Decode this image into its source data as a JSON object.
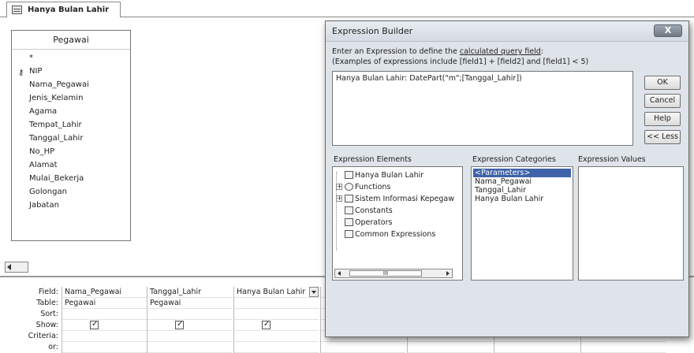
{
  "tab": {
    "title": "Hanya Bulan Lahir",
    "icon": "query-table-icon"
  },
  "table": {
    "name": "Pegawai",
    "fields": [
      "*",
      "NIP",
      "Nama_Pegawai",
      "Jenis_Kelamin",
      "Agama",
      "Tempat_Lahir",
      "Tanggal_Lahir",
      "No_HP",
      "Alamat",
      "Mulai_Bekerja",
      "Golongan",
      "Jabatan"
    ],
    "key_field": "NIP"
  },
  "grid": {
    "row_labels": [
      "Field:",
      "Table:",
      "Sort:",
      "Show:",
      "Criteria:",
      "or:"
    ],
    "columns": [
      {
        "field": "Nama_Pegawai",
        "table": "Pegawai",
        "sort": "",
        "show": true
      },
      {
        "field": "Tanggal_Lahir",
        "table": "Pegawai",
        "sort": "",
        "show": true
      },
      {
        "field": "Hanya Bulan Lahir",
        "table": "",
        "sort": "",
        "show": true
      }
    ]
  },
  "dialog": {
    "title": "Expression Builder",
    "close_label": "X",
    "instruction_pre": "Enter an Expression to define the ",
    "instruction_link": "calculated query field",
    "instruction_post": ":",
    "examples": "(Examples of expressions include [field1] + [field2] and [field1] < 5)",
    "expression": "Hanya Bulan Lahir: DatePart(\"m\";[Tanggal_Lahir])",
    "buttons": {
      "ok": "OK",
      "cancel": "Cancel",
      "help": "Help",
      "less": "<< Less"
    },
    "elements_label": "Expression Elements",
    "categories_label": "Expression Categories",
    "values_label": "Expression Values",
    "elements": [
      {
        "label": "Hanya Bulan Lahir",
        "expandable": false,
        "icon": "query-icon"
      },
      {
        "label": "Functions",
        "expandable": true,
        "icon": "function-icon"
      },
      {
        "label": "Sistem Informasi Kepegaw",
        "expandable": true,
        "icon": "database-icon"
      },
      {
        "label": "Constants",
        "expandable": false,
        "icon": "constants-icon"
      },
      {
        "label": "Operators",
        "expandable": false,
        "icon": "operators-icon"
      },
      {
        "label": "Common Expressions",
        "expandable": false,
        "icon": "common-expressions-icon"
      }
    ],
    "categories": [
      "<Parameters>",
      "Nama_Pegawai",
      "Tanggal_Lahir",
      "Hanya Bulan Lahir"
    ],
    "selected_category": "<Parameters>",
    "scroll_thumb": "III"
  },
  "colors": {
    "selection": "#3f62a8",
    "dialog_bg": "#dfe4ea",
    "close_button": "#6f7984"
  }
}
